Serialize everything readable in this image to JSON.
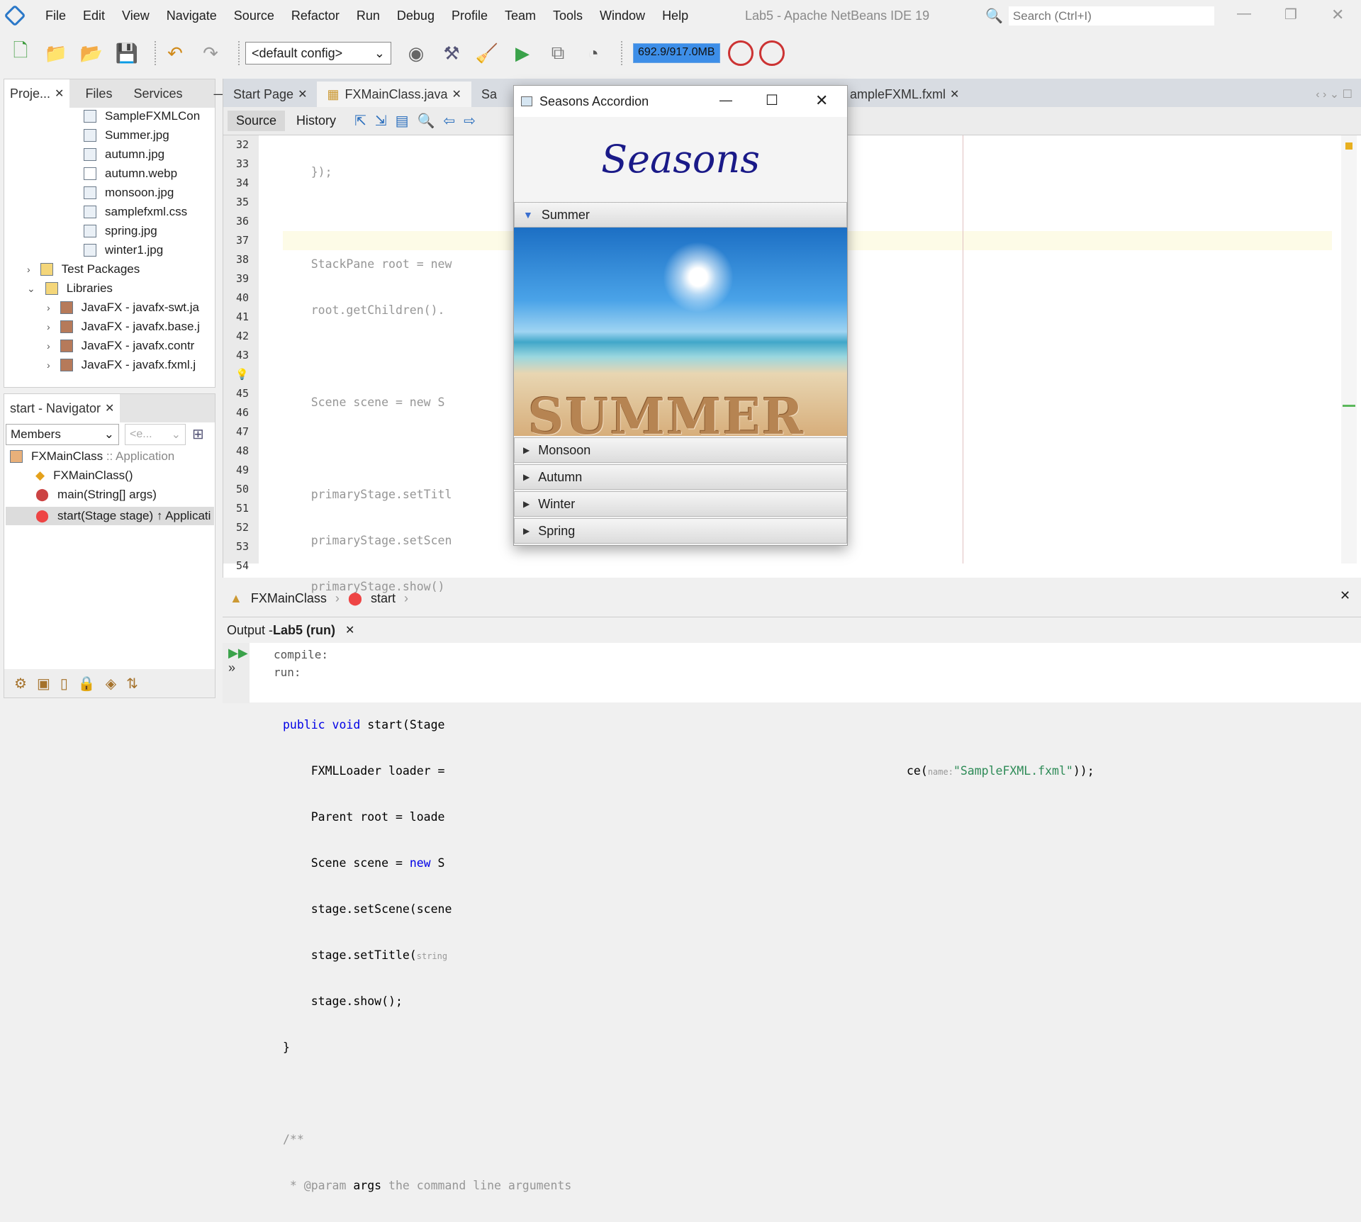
{
  "menu": [
    "File",
    "Edit",
    "View",
    "Navigate",
    "Source",
    "Refactor",
    "Run",
    "Debug",
    "Profile",
    "Team",
    "Tools",
    "Window",
    "Help"
  ],
  "window_title": "Lab5 - Apache NetBeans IDE 19",
  "search": {
    "placeholder": "Search (Ctrl+I)"
  },
  "toolbar": {
    "config": "<default config>",
    "memory": "692.9/917.0MB"
  },
  "projects": {
    "tabs": [
      "Proje...",
      "Files",
      "Services"
    ],
    "files": [
      "SampleFXMLCon",
      "Summer.jpg",
      "autumn.jpg",
      "autumn.webp",
      "monsoon.jpg",
      "samplefxml.css",
      "spring.jpg",
      "winter1.jpg"
    ],
    "nodes": [
      "Test Packages",
      "Libraries"
    ],
    "libs": [
      "JavaFX - javafx-swt.ja",
      "JavaFX - javafx.base.j",
      "JavaFX - javafx.contr",
      "JavaFX - javafx.fxml.j"
    ]
  },
  "navigator": {
    "title": "start - Navigator",
    "filter": "Members",
    "filter2": "<e...",
    "class": "FXMainClass",
    "class_suffix": ":: Application",
    "members": [
      "FXMainClass()",
      "main(String[] args)",
      "start(Stage stage) ↑ Applicati"
    ]
  },
  "editor": {
    "tabs": [
      "Start Page",
      "FXMainClass.java",
      "Sa",
      "ampleFXML.fxml"
    ],
    "source_tab": "Source",
    "history_tab": "History",
    "line_numbers": [
      "32",
      "33",
      "34",
      "35",
      "36",
      "37",
      "38",
      "39",
      "40",
      "41",
      "42",
      "43",
      "44",
      "45",
      "46",
      "47",
      "48",
      "49",
      "50",
      "51",
      "52",
      "53",
      "54"
    ],
    "lines": {
      "l32": "    });",
      "l34": "    StackPane root = new",
      "l35": "    root.getChildren().",
      "l37": "    Scene scene = new S",
      "l39": "    primaryStage.setTitl",
      "l40": "    primaryStage.setScen",
      "l41": "    primaryStage.show()",
      "l42": "}*/",
      "l44a": "public void",
      "l44b": " start(Stage",
      "l45": "    FXMLLoader loader =",
      "l45b": "ce(",
      "l45hint": "name:",
      "l45str": "\"SampleFXML.fxml\"",
      "l45end": "));",
      "l46": "    Parent root = loade",
      "l47a": "    Scene scene = ",
      "l47b": "new",
      "l47c": " S",
      "l48": "    stage.setScene(scene",
      "l49": "    stage.setTitle(",
      "l49hint": "string",
      "l50": "    stage.show();",
      "l51": "}",
      "l53": "/**",
      "l54a": " * @param",
      "l54b": " args",
      "l54c": " the command line arguments"
    }
  },
  "breadcrumb": {
    "class": "FXMainClass",
    "method": "start"
  },
  "output": {
    "title": "Output - ",
    "project": "Lab5 (run)",
    "lines": [
      "compile:",
      "run:"
    ]
  },
  "fxwindow": {
    "title": "Seasons Accordion",
    "heading": "Seasons",
    "panes": [
      "Summer",
      "Monsoon",
      "Autumn",
      "Winter",
      "Spring"
    ],
    "image_text": "SUMMER"
  }
}
